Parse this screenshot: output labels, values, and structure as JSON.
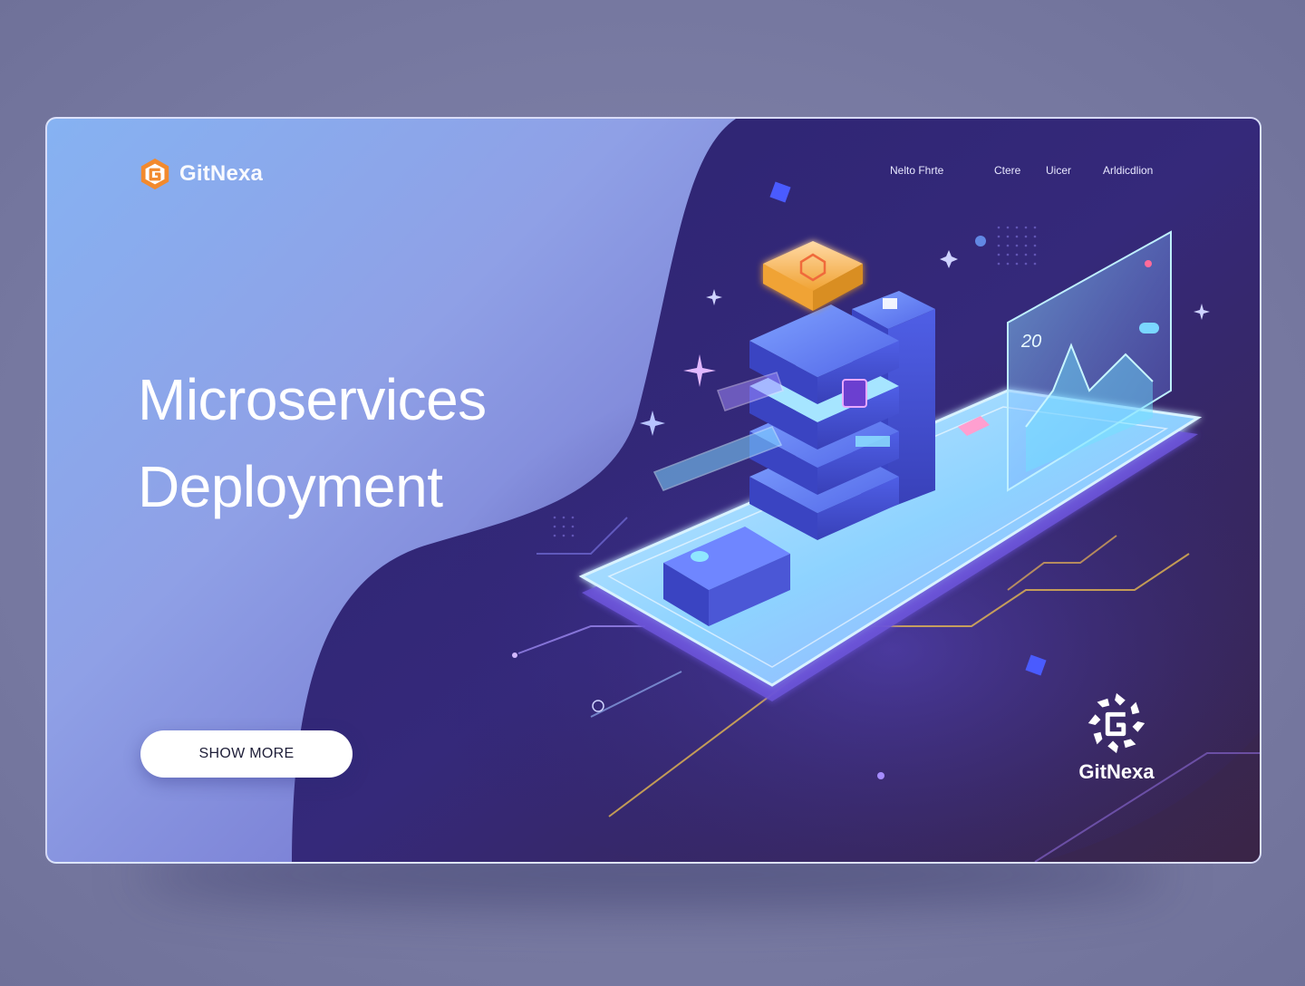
{
  "brand": {
    "name": "GitNexa",
    "accent": "#f28a2e"
  },
  "nav": {
    "items": [
      "Nelto Fhrte",
      "Ctere",
      "Uicer",
      "Arldicdlion"
    ]
  },
  "hero": {
    "title_line1": "Microservices",
    "title_line2": "Deployment",
    "cta_label": "SHOW MORE"
  },
  "illustration": {
    "chart_panel_label": "20"
  },
  "footer_brand": {
    "name": "GitNexa"
  },
  "colors": {
    "background": "#7a7ba3",
    "card_light": "#86b2f2",
    "card_dark": "#2a2466",
    "glow_cyan": "#6fe3ff",
    "glow_gold": "#f2c14e"
  }
}
